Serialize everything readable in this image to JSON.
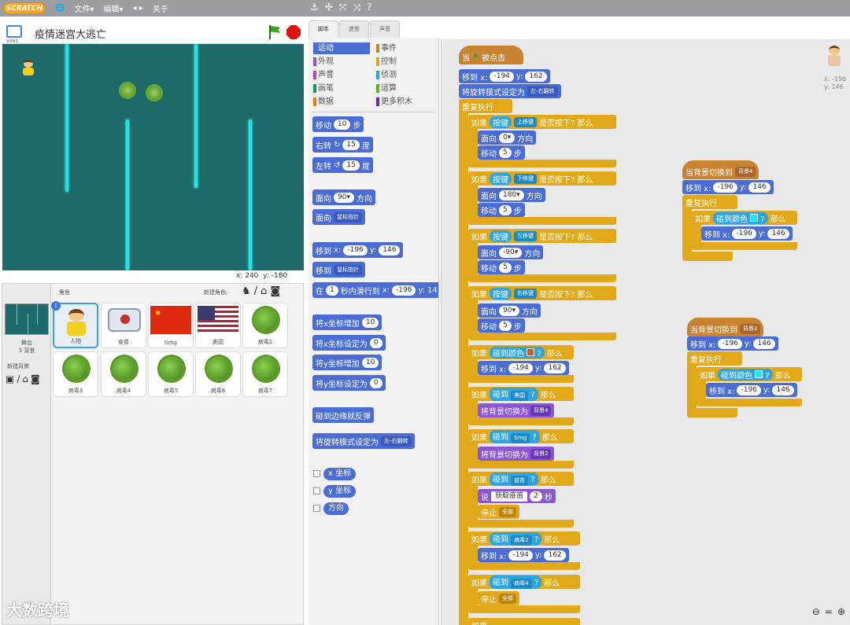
{
  "menu": {
    "logo": "SCRATCH",
    "file": "文件▾",
    "edit": "编辑▾",
    "tips": "◂ ▸",
    "about": "关于"
  },
  "stage": {
    "title": "疫情迷宫大逃亡",
    "version": "v461",
    "x_label": "x:",
    "x_value": "240",
    "y_label": "y:",
    "y_value": "-180"
  },
  "sprites": {
    "header": "角色",
    "new_sprite": "新建角色:",
    "stage_label": "舞台",
    "stage_sub": "3 背景",
    "new_backdrop": "新建背景",
    "items": [
      {
        "name": "人物"
      },
      {
        "name": "疫苗"
      },
      {
        "name": "timg"
      },
      {
        "name": "美国"
      },
      {
        "name": "病毒2"
      },
      {
        "name": "病毒3"
      },
      {
        "name": "病毒4"
      },
      {
        "name": "病毒5"
      },
      {
        "name": "病毒6"
      },
      {
        "name": "病毒7"
      }
    ]
  },
  "tabs": [
    "脚本",
    "造型",
    "声音"
  ],
  "categories": [
    {
      "label": "运动",
      "color": "#4a6cd4",
      "selected": true
    },
    {
      "label": "外观",
      "color": "#8a55d7"
    },
    {
      "label": "声音",
      "color": "#bb42c3"
    },
    {
      "label": "画笔",
      "color": "#0e9a6c"
    },
    {
      "label": "数据",
      "color": "#ee7d16"
    },
    {
      "label": "事件",
      "color": "#c88330"
    },
    {
      "label": "控制",
      "color": "#e1a91a"
    },
    {
      "label": "侦测",
      "color": "#2ca5e2"
    },
    {
      "label": "运算",
      "color": "#5cb712"
    },
    {
      "label": "更多积木",
      "color": "#632d99"
    }
  ],
  "palette": {
    "move": "移动",
    "move_val": "10",
    "steps": "步",
    "turn_right": "右转",
    "turn_r_val": "15",
    "deg": "度",
    "turn_left": "左转",
    "turn_l_val": "15",
    "point_dir": "面向",
    "dir_val": "90▾",
    "direction": "方向",
    "point_towards": "面向",
    "mouse": "鼠标指针",
    "goto": "移到",
    "x": "x:",
    "x_val": "-196",
    "y": "y:",
    "y_val": "146",
    "goto2": "移到",
    "mouse2": "鼠标指针",
    "glide_in": "在",
    "glide_sec": "1",
    "glide_text": "秒内滑行到",
    "glide_x": "-196",
    "glide_y": "14",
    "change_x": "将x坐标增加",
    "change_x_val": "10",
    "set_x": "将x坐标设定为",
    "set_x_val": "0",
    "change_y": "将y坐标增加",
    "change_y_val": "10",
    "set_y": "将y坐标设定为",
    "set_y_val": "0",
    "bounce": "碰到边缘就反弹",
    "rotation": "将旋转模式设定为",
    "rotation_val": "左-右翻转",
    "rep_x": "x 坐标",
    "rep_y": "y 坐标",
    "rep_dir": "方向"
  },
  "scripts": {
    "when_flag": "当",
    "clicked": "被点击",
    "goto": "移到 x:",
    "gx": "-194",
    "y": "y:",
    "gy": "162",
    "rotation": "将旋转模式设定为",
    "rotation_val": "左-右翻转",
    "forever": "重复执行",
    "if": "如果",
    "key": "按键",
    "pressed": "是否按下?",
    "then": "那么",
    "up": "上移键",
    "down": "下移键",
    "left": "左移键",
    "right": "右移键",
    "face": "面向",
    "deg0": "0▾",
    "deg180": "180▾",
    "degm90": "-90▾",
    "deg90": "90▾",
    "dir": "方向",
    "move": "移动",
    "five": "5",
    "step": "步",
    "touch_color": "碰到颜色",
    "q": "?",
    "touch": "碰到",
    "usa": "美国",
    "timg": "timg",
    "vaccine": "疫苗",
    "virus2": "病毒2",
    "virus4": "病毒4",
    "switch_bg": "将背景切换为",
    "bg4": "背景4",
    "bg2": "背景2",
    "say": "说",
    "say_text": "获取疫苗",
    "say_sec": "2",
    "sec": "秒",
    "stop": "停止",
    "all": "全部",
    "when_bg": "当背景切换到",
    "to": "移到 x:",
    "tx": "-196",
    "ty": "146"
  },
  "script_sprite": {
    "x": "x: -196",
    "y": "y: 146"
  },
  "watermark": "大数跨境"
}
